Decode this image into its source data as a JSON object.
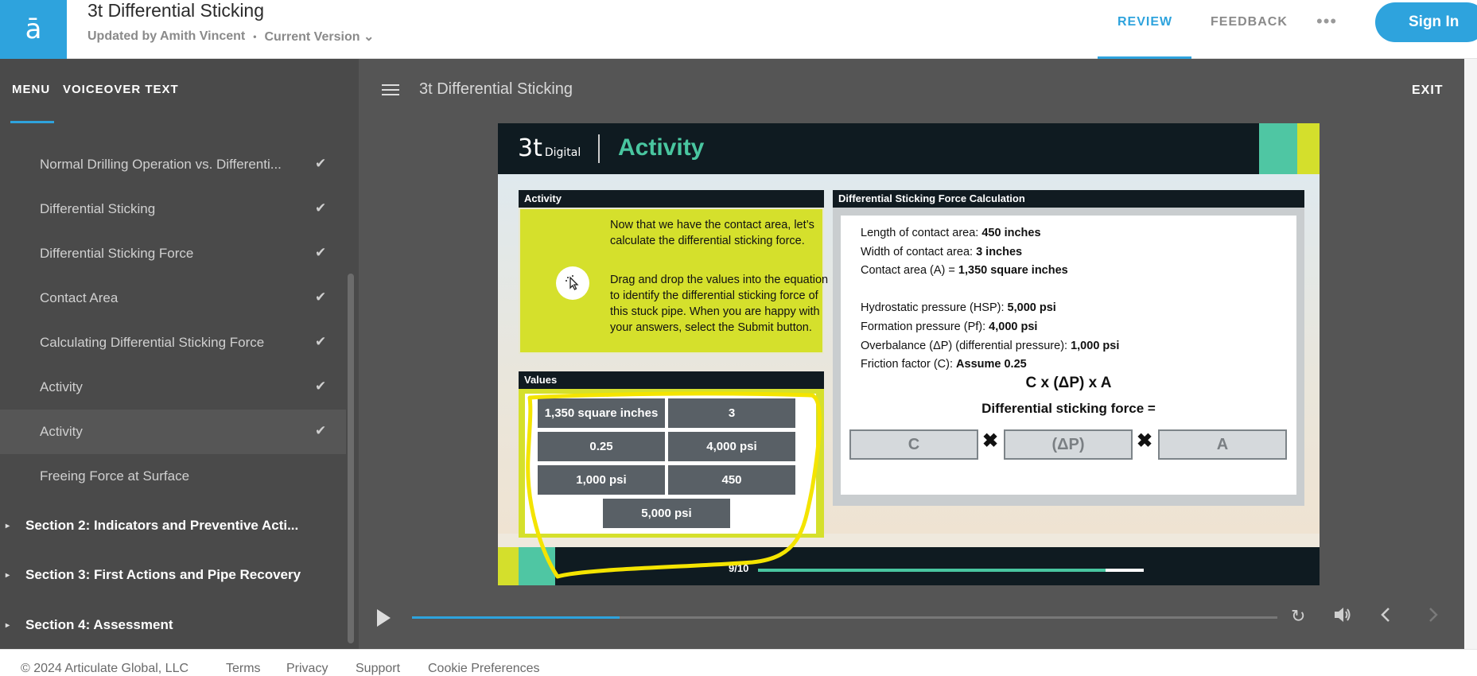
{
  "header": {
    "logo_glyph": "ā",
    "title": "3t Differential Sticking",
    "updated_by": "Updated by Amith Vincent",
    "separator": "•",
    "version": "Current Version",
    "version_chevron": "⌄",
    "review": "REVIEW",
    "feedback": "FEEDBACK",
    "more": "•••",
    "sign_in": "Sign In"
  },
  "sidebar": {
    "tabs": [
      "MENU",
      "VOICEOVER TEXT"
    ],
    "items": [
      {
        "label": "Normal Drilling Operation vs. Differenti...",
        "check": "✔"
      },
      {
        "label": "Differential Sticking",
        "check": "✔"
      },
      {
        "label": "Differential Sticking Force",
        "check": "✔"
      },
      {
        "label": "Contact Area",
        "check": "✔"
      },
      {
        "label": "Calculating Differential Sticking Force",
        "check": "✔"
      },
      {
        "label": "Activity",
        "check": "✔"
      },
      {
        "label": "Activity",
        "check": "✔"
      },
      {
        "label": "Freeing Force at Surface",
        "check": ""
      }
    ],
    "sections": [
      {
        "label": "Section 2: Indicators and Preventive Acti..."
      },
      {
        "label": "Section 3: First Actions and Pipe Recovery"
      },
      {
        "label": "Section 4: Assessment"
      }
    ],
    "section_arrow": "▸"
  },
  "player": {
    "title": "3t Differential Sticking",
    "exit": "EXIT",
    "seek_progress": 0.24
  },
  "slide": {
    "brand": "3t",
    "brand_sub": "Digital",
    "heading": "Activity",
    "activity_panel": {
      "title": "Activity",
      "text1": "Now that we have the contact area, let’s calculate the differential sticking force.",
      "text2": "Drag and drop the values into the equation to identify the differential sticking force of this stuck pipe. When you are happy with your answers, select the Submit button."
    },
    "values_panel": {
      "title": "Values",
      "cells": [
        "1,350 square inches",
        "3",
        "0.25",
        "4,000 psi",
        "1,000 psi",
        "450",
        "5,000 psi"
      ]
    },
    "calc_panel": {
      "title": "Differential Sticking Force Calculation",
      "lines": [
        {
          "label": "Length of contact area: ",
          "value": "450 inches"
        },
        {
          "label": "Width of contact area: ",
          "value": "3 inches"
        },
        {
          "label": "Contact area (A) = ",
          "value": "1,350 square inches"
        },
        {
          "label": "Hydrostatic pressure (HSP): ",
          "value": "5,000 psi"
        },
        {
          "label": "Formation pressure (Pf): ",
          "value": "4,000 psi"
        },
        {
          "label": "Overbalance (ΔP) (differential pressure): ",
          "value": "1,000 psi"
        },
        {
          "label": "Friction factor (C): ",
          "value": "Assume 0.25"
        }
      ],
      "formula": "C x (ΔP) x A",
      "result_label": "Differential sticking force =",
      "slots": [
        "C",
        "(ΔP)",
        "A"
      ],
      "times": "✖"
    },
    "progress": {
      "label": "9/10",
      "fraction": 0.9
    }
  },
  "footer": {
    "copyright": "© 2024 Articulate Global, LLC",
    "links": [
      "Terms",
      "Privacy",
      "Support",
      "Cookie Preferences"
    ]
  }
}
